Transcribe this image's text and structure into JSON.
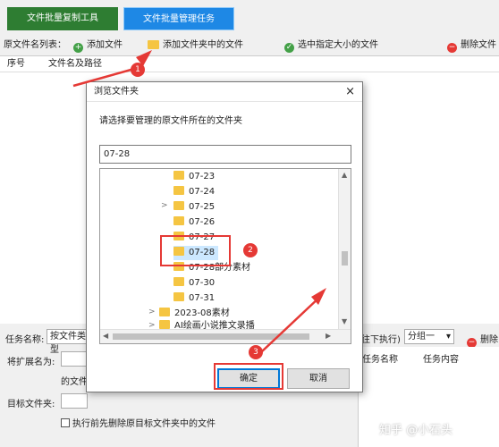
{
  "tabs": {
    "copy_tool": "文件批量复制工具",
    "manage_task": "文件批量管理任务"
  },
  "toolbar": {
    "list_label": "原文件名列表：",
    "add_file": "添加文件",
    "add_folder_files": "添加文件夹中的文件",
    "select_size": "选中指定大小的文件",
    "delete_file": "删除文件"
  },
  "table": {
    "col_index": "序号",
    "col_path": "文件名及路径"
  },
  "lower": {
    "task_name_label": "任务名称:",
    "task_name_value": "按文件类型",
    "ext_label": "将扩展名为:",
    "file_label": "的文件",
    "target_label": "目标文件夹:",
    "delete_checkbox": "执行前先删除原目标文件夹中的文件",
    "exec_hint": "往下执行)",
    "group_value": "分组一",
    "delete_right": "删除",
    "task_col_name": "任务名称",
    "task_col_content": "任务内容"
  },
  "dialog": {
    "title": "浏览文件夹",
    "close": "×",
    "prompt": "请选择要管理的原文件所在的文件夹",
    "path_value": "07-28",
    "folders": [
      "07-23",
      "07-24",
      "07-25",
      "07-26",
      "07-27",
      "07-28",
      "07-28部分素材",
      "07-30",
      "07-31",
      "2023-08素材",
      "AI绘画小说推文录播"
    ],
    "ok": "确定",
    "cancel": "取消"
  },
  "annotations": {
    "step1": "1",
    "step2": "2",
    "step3": "3"
  },
  "watermark": "知乎 @小石头",
  "colors": {
    "accent": "#1e88e5",
    "green": "#2e7d32",
    "annotation": "#e53935"
  }
}
